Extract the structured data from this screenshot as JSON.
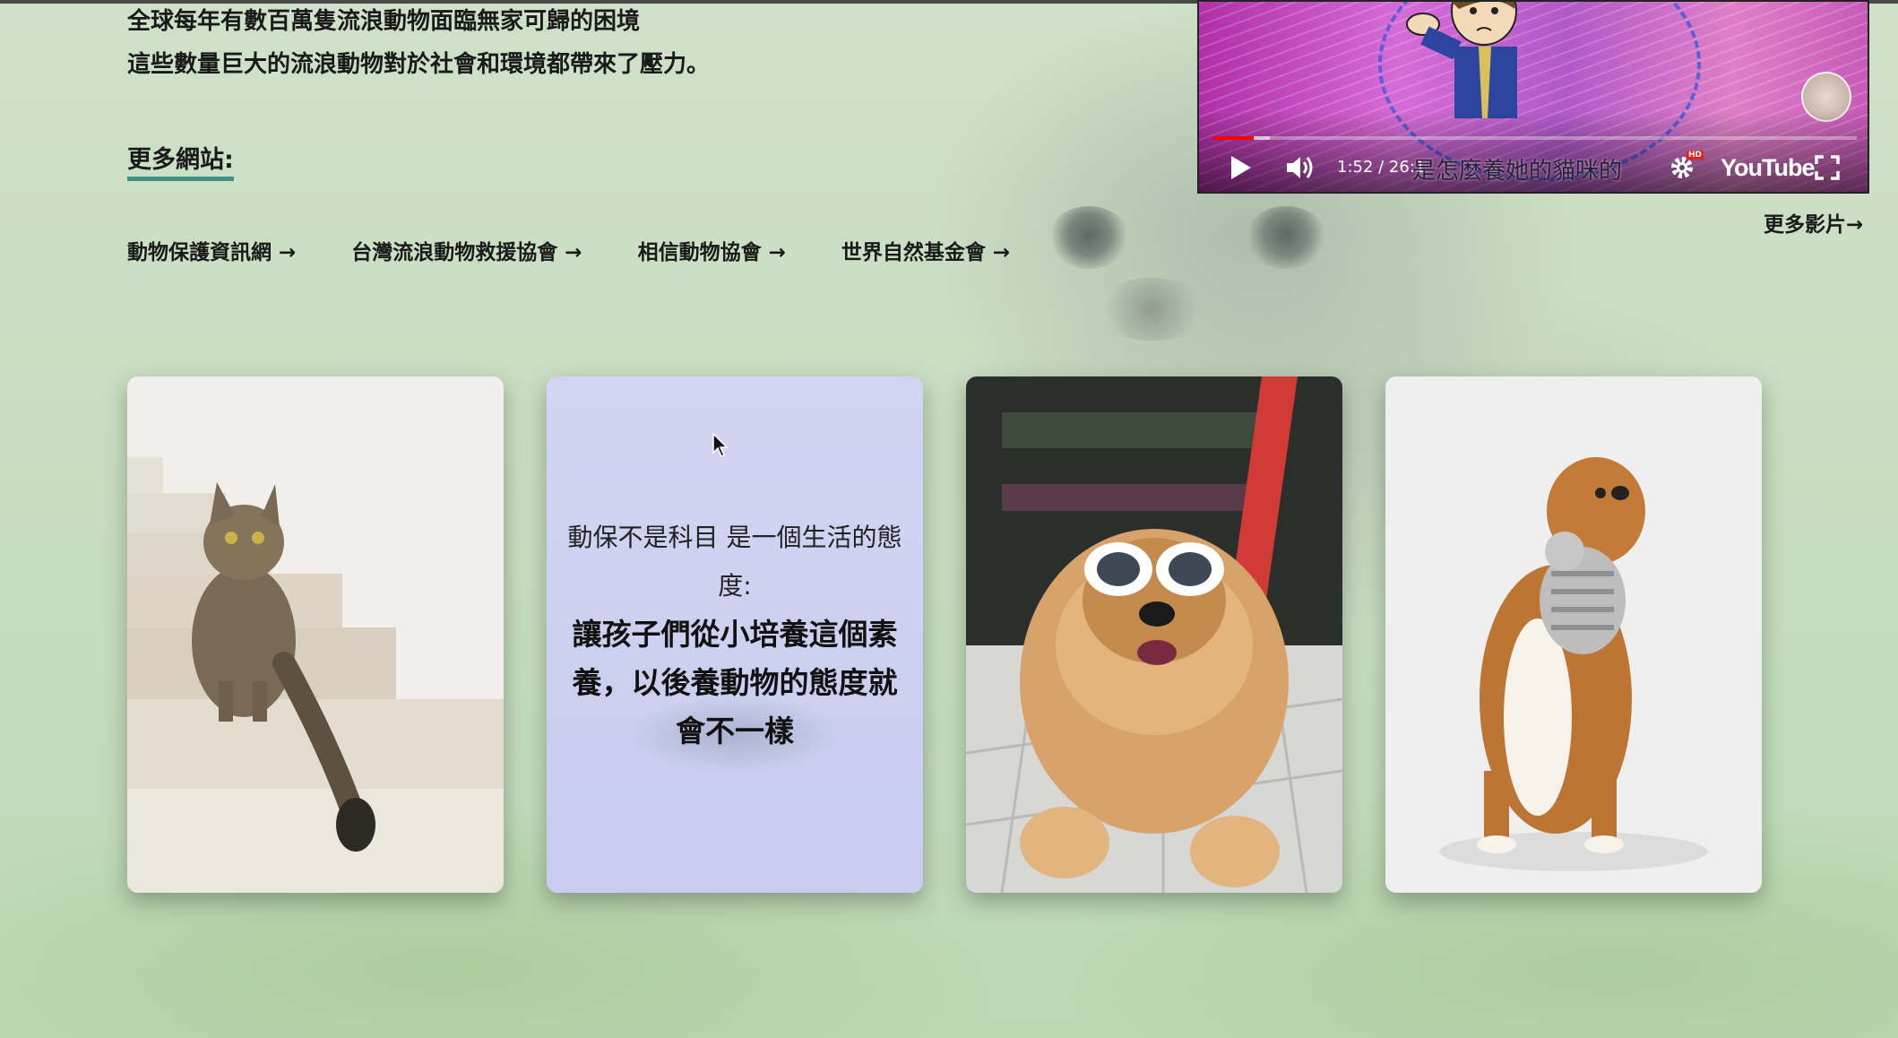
{
  "intro": {
    "line1": "全球每年有數百萬隻流浪動物面臨無家可歸的困境",
    "line2": "這些數量巨大的流浪動物對於社會和環境都帶來了壓力。"
  },
  "more_sites": {
    "heading": "更多網站:",
    "links": [
      {
        "label": "動物保護資訊網 →"
      },
      {
        "label": "台灣流浪動物救援協會 →"
      },
      {
        "label": "相信動物協會 →"
      },
      {
        "label": "世界自然基金會 →"
      }
    ]
  },
  "video": {
    "time": "1:52 / 26:1",
    "caption": "是怎麼養她的貓咪的",
    "hd_badge": "HD",
    "logo": "YouTube",
    "progress": 0.063,
    "buffered": 0.065,
    "icons": [
      "play-icon",
      "volume-icon",
      "settings-icon",
      "fullscreen-icon"
    ]
  },
  "more_videos": "更多影片→",
  "cards": [
    {
      "type": "image",
      "subject": "cat-on-stairs"
    },
    {
      "type": "text",
      "line1": "動保不是科目 是一個生活的態度:",
      "line2": "讓孩子們從小培養這個素養，以後養動物的態度就會不一樣"
    },
    {
      "type": "image",
      "subject": "dog-with-sunglasses"
    },
    {
      "type": "image",
      "subject": "dog-with-toy"
    }
  ],
  "colors": {
    "accent_underline": "#3f8f83",
    "text_card_bg": "#cdd0f0",
    "progress_red": "#ff0000"
  }
}
